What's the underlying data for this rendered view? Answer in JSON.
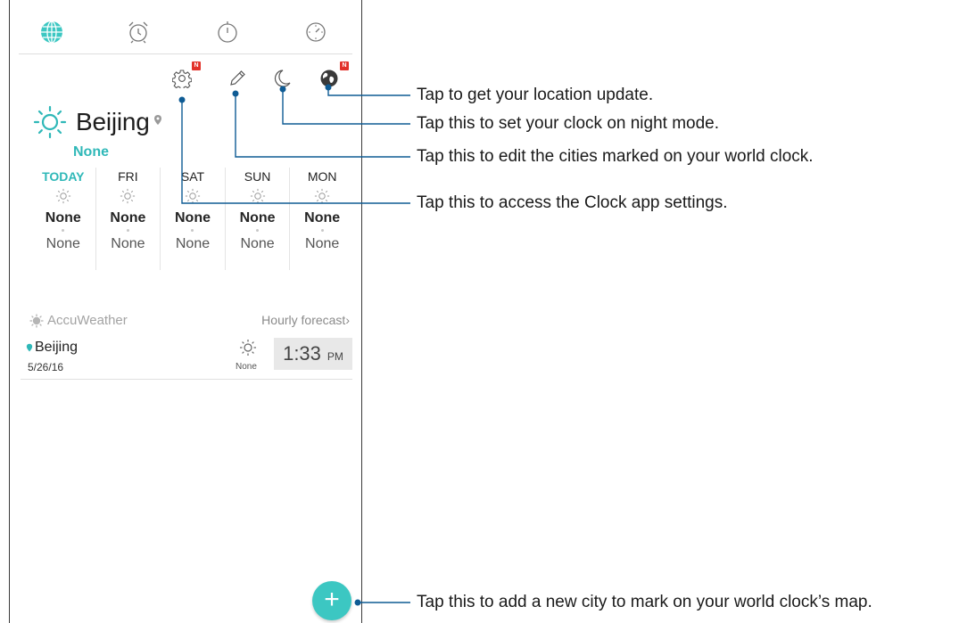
{
  "city": {
    "name": "Beijing",
    "condition": "None"
  },
  "forecast": [
    {
      "day": "TODAY",
      "high": "None",
      "low": "None"
    },
    {
      "day": "FRI",
      "high": "None",
      "low": "None"
    },
    {
      "day": "SAT",
      "high": "None",
      "low": "None"
    },
    {
      "day": "SUN",
      "high": "None",
      "low": "None"
    },
    {
      "day": "MON",
      "high": "None",
      "low": "None"
    }
  ],
  "brand": "AccuWeather",
  "hourly_link": "Hourly forecast",
  "clock_entry": {
    "city": "Beijing",
    "date": "5/26/16",
    "weather": "None",
    "time": "1:33",
    "ampm": "PM"
  },
  "badges": {
    "settings": "N",
    "location": "N"
  },
  "fab_label": "+",
  "annotations": {
    "location": "Tap to get your location update.",
    "night_mode": "Tap this to set your clock on night mode.",
    "edit": "Tap this to edit the cities marked on your world clock.",
    "settings": "Tap this to access the Clock app settings.",
    "add_city": "Tap this to add a new city to mark on your world clock’s map."
  },
  "colors": {
    "accent": "#2fb8b8",
    "fab": "#3cc7c2",
    "callout_line": "#0e5b94",
    "badge": "#e2322a"
  },
  "icons": [
    "world-clock-icon",
    "alarm-icon",
    "stopwatch-icon",
    "timer-icon",
    "settings-gear-icon",
    "pencil-edit-icon",
    "moon-icon",
    "location-globe-icon",
    "sun-icon",
    "location-pin-icon"
  ]
}
